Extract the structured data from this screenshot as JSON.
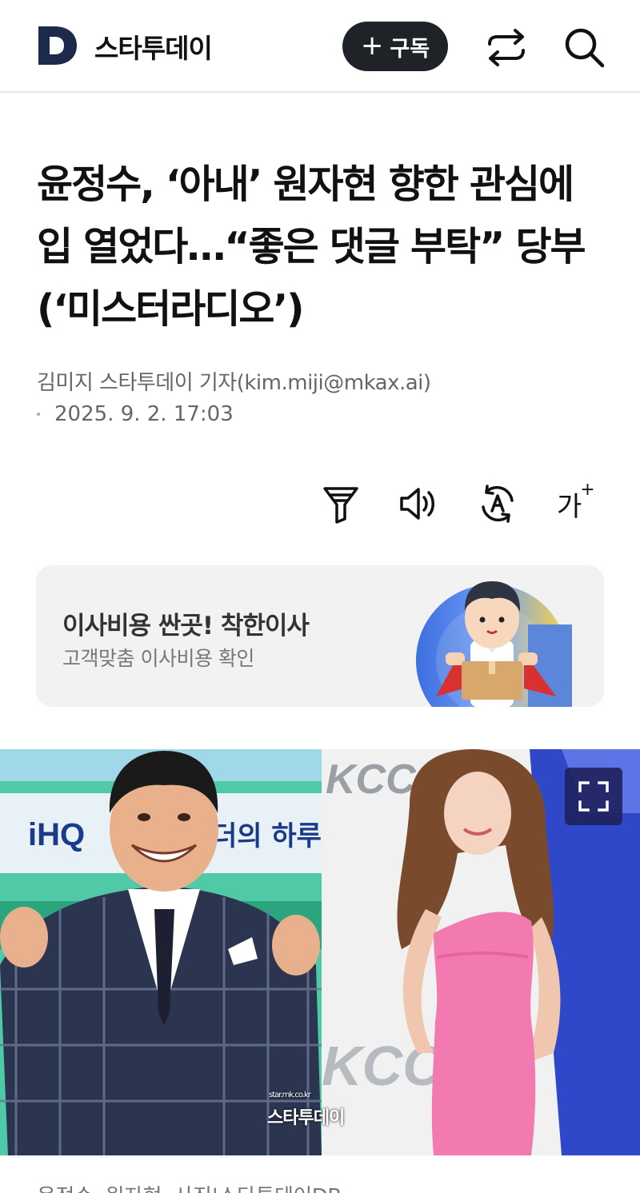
{
  "header": {
    "logo_letter": "D",
    "brand": "스타투데이",
    "subscribe_label": "구독",
    "subscribe_plus": "+",
    "share_icon": "share-icon",
    "search_icon": "search-icon"
  },
  "article": {
    "headline": "윤정수, ‘아내’ 원자현 향한 관심에 입 열었다…“좋은 댓글 부탁” 당부 (‘미스터라디오’)",
    "byline": "김미지 스타투데이 기자(kim.miji@mkax.ai)",
    "date": "2025. 9. 2. 17:03",
    "tools": {
      "summary_icon": "filter-icon",
      "listen_icon": "speaker-icon",
      "translate_icon": "translate-icon",
      "font_size_label": "가",
      "font_size_plus": "+"
    }
  },
  "ad": {
    "title": "이사비용 싼곳! 착한이사",
    "subtitle": "고객맞춤 이사비용 확인"
  },
  "photo": {
    "watermark": "스타투데이",
    "watermark_small": "star.mk.co.kr",
    "expand_icon": "expand-icon",
    "left_sign_1": "iHQ",
    "left_sign_2": "더의 하루",
    "right_sign_1": "KCC",
    "right_sign_2": "KCC"
  },
  "caption": "윤정수, 원자현. 사진|스타투데이DB",
  "colors": {
    "accent_dark": "#1f2327",
    "logo_navy": "#1e2a4a",
    "expand_bg": "#1e235f"
  }
}
